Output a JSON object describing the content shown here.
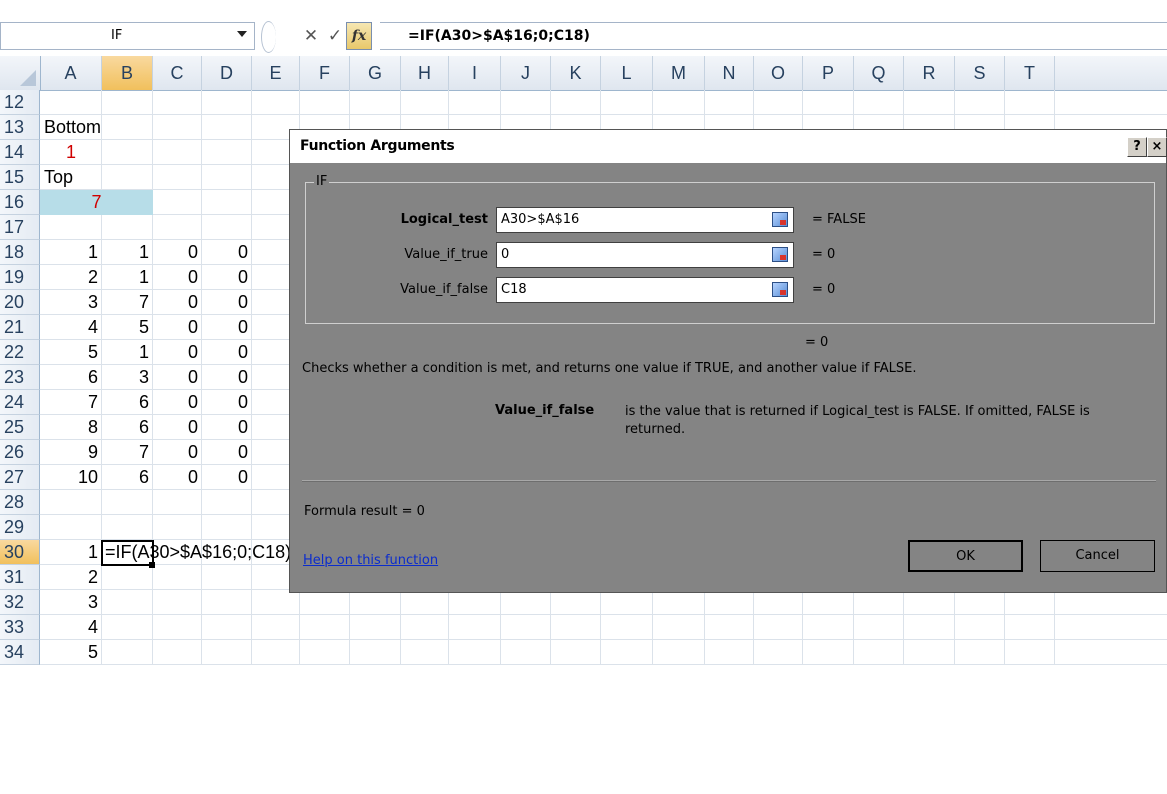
{
  "formula_bar": {
    "name_box": "IF",
    "cancel_glyph": "✕",
    "enter_glyph": "✓",
    "fx_label": "fx",
    "formula": "=IF(A30>$A$16;0;C18)"
  },
  "grid": {
    "columns": [
      "A",
      "B",
      "C",
      "D",
      "E",
      "F",
      "G",
      "H",
      "I",
      "J",
      "K",
      "L",
      "M",
      "N",
      "O",
      "P",
      "Q",
      "R",
      "S",
      "T"
    ],
    "selected_column": "B",
    "rows": [
      "12",
      "13",
      "14",
      "15",
      "16",
      "17",
      "18",
      "19",
      "20",
      "21",
      "22",
      "23",
      "24",
      "25",
      "26",
      "27",
      "28",
      "29",
      "30",
      "31",
      "32",
      "33",
      "34"
    ],
    "selected_row": "30",
    "labels": {
      "A13": "Bottom",
      "A15": "Top"
    },
    "bottom_value": "1",
    "top_value": "7",
    "table_rows": [
      [
        "1",
        "1",
        "0",
        "0"
      ],
      [
        "2",
        "1",
        "0",
        "0"
      ],
      [
        "3",
        "7",
        "0",
        "0"
      ],
      [
        "4",
        "5",
        "0",
        "0"
      ],
      [
        "5",
        "1",
        "0",
        "0"
      ],
      [
        "6",
        "3",
        "0",
        "0"
      ],
      [
        "7",
        "6",
        "0",
        "0"
      ],
      [
        "8",
        "6",
        "0",
        "0"
      ],
      [
        "9",
        "7",
        "0",
        "0"
      ],
      [
        "10",
        "6",
        "0",
        "0"
      ]
    ],
    "lower_values": [
      "1",
      "2",
      "3",
      "4",
      "5"
    ],
    "active_cell_text": "=IF(A30>$A$16;0;C18)"
  },
  "dialog": {
    "title": "Function Arguments",
    "help_btn": "?",
    "close_btn": "×",
    "group_label": "IF",
    "args": [
      {
        "label": "Logical_test",
        "value": "A30>$A$16",
        "result": "=  FALSE"
      },
      {
        "label": "Value_if_true",
        "value": "0",
        "result": "=  0"
      },
      {
        "label": "Value_if_false",
        "value": "C18",
        "result": "=  0"
      }
    ],
    "overall_result": "=  0",
    "description": "Checks whether a condition is met, and returns one value if TRUE, and another value if FALSE.",
    "arg_desc_name": "Value_if_false",
    "arg_desc": "is the value that is returned if Logical_test is FALSE. If omitted, FALSE is returned.",
    "formula_result": "Formula result =   0",
    "help_link": "Help on this function",
    "ok": "OK",
    "cancel": "Cancel"
  }
}
